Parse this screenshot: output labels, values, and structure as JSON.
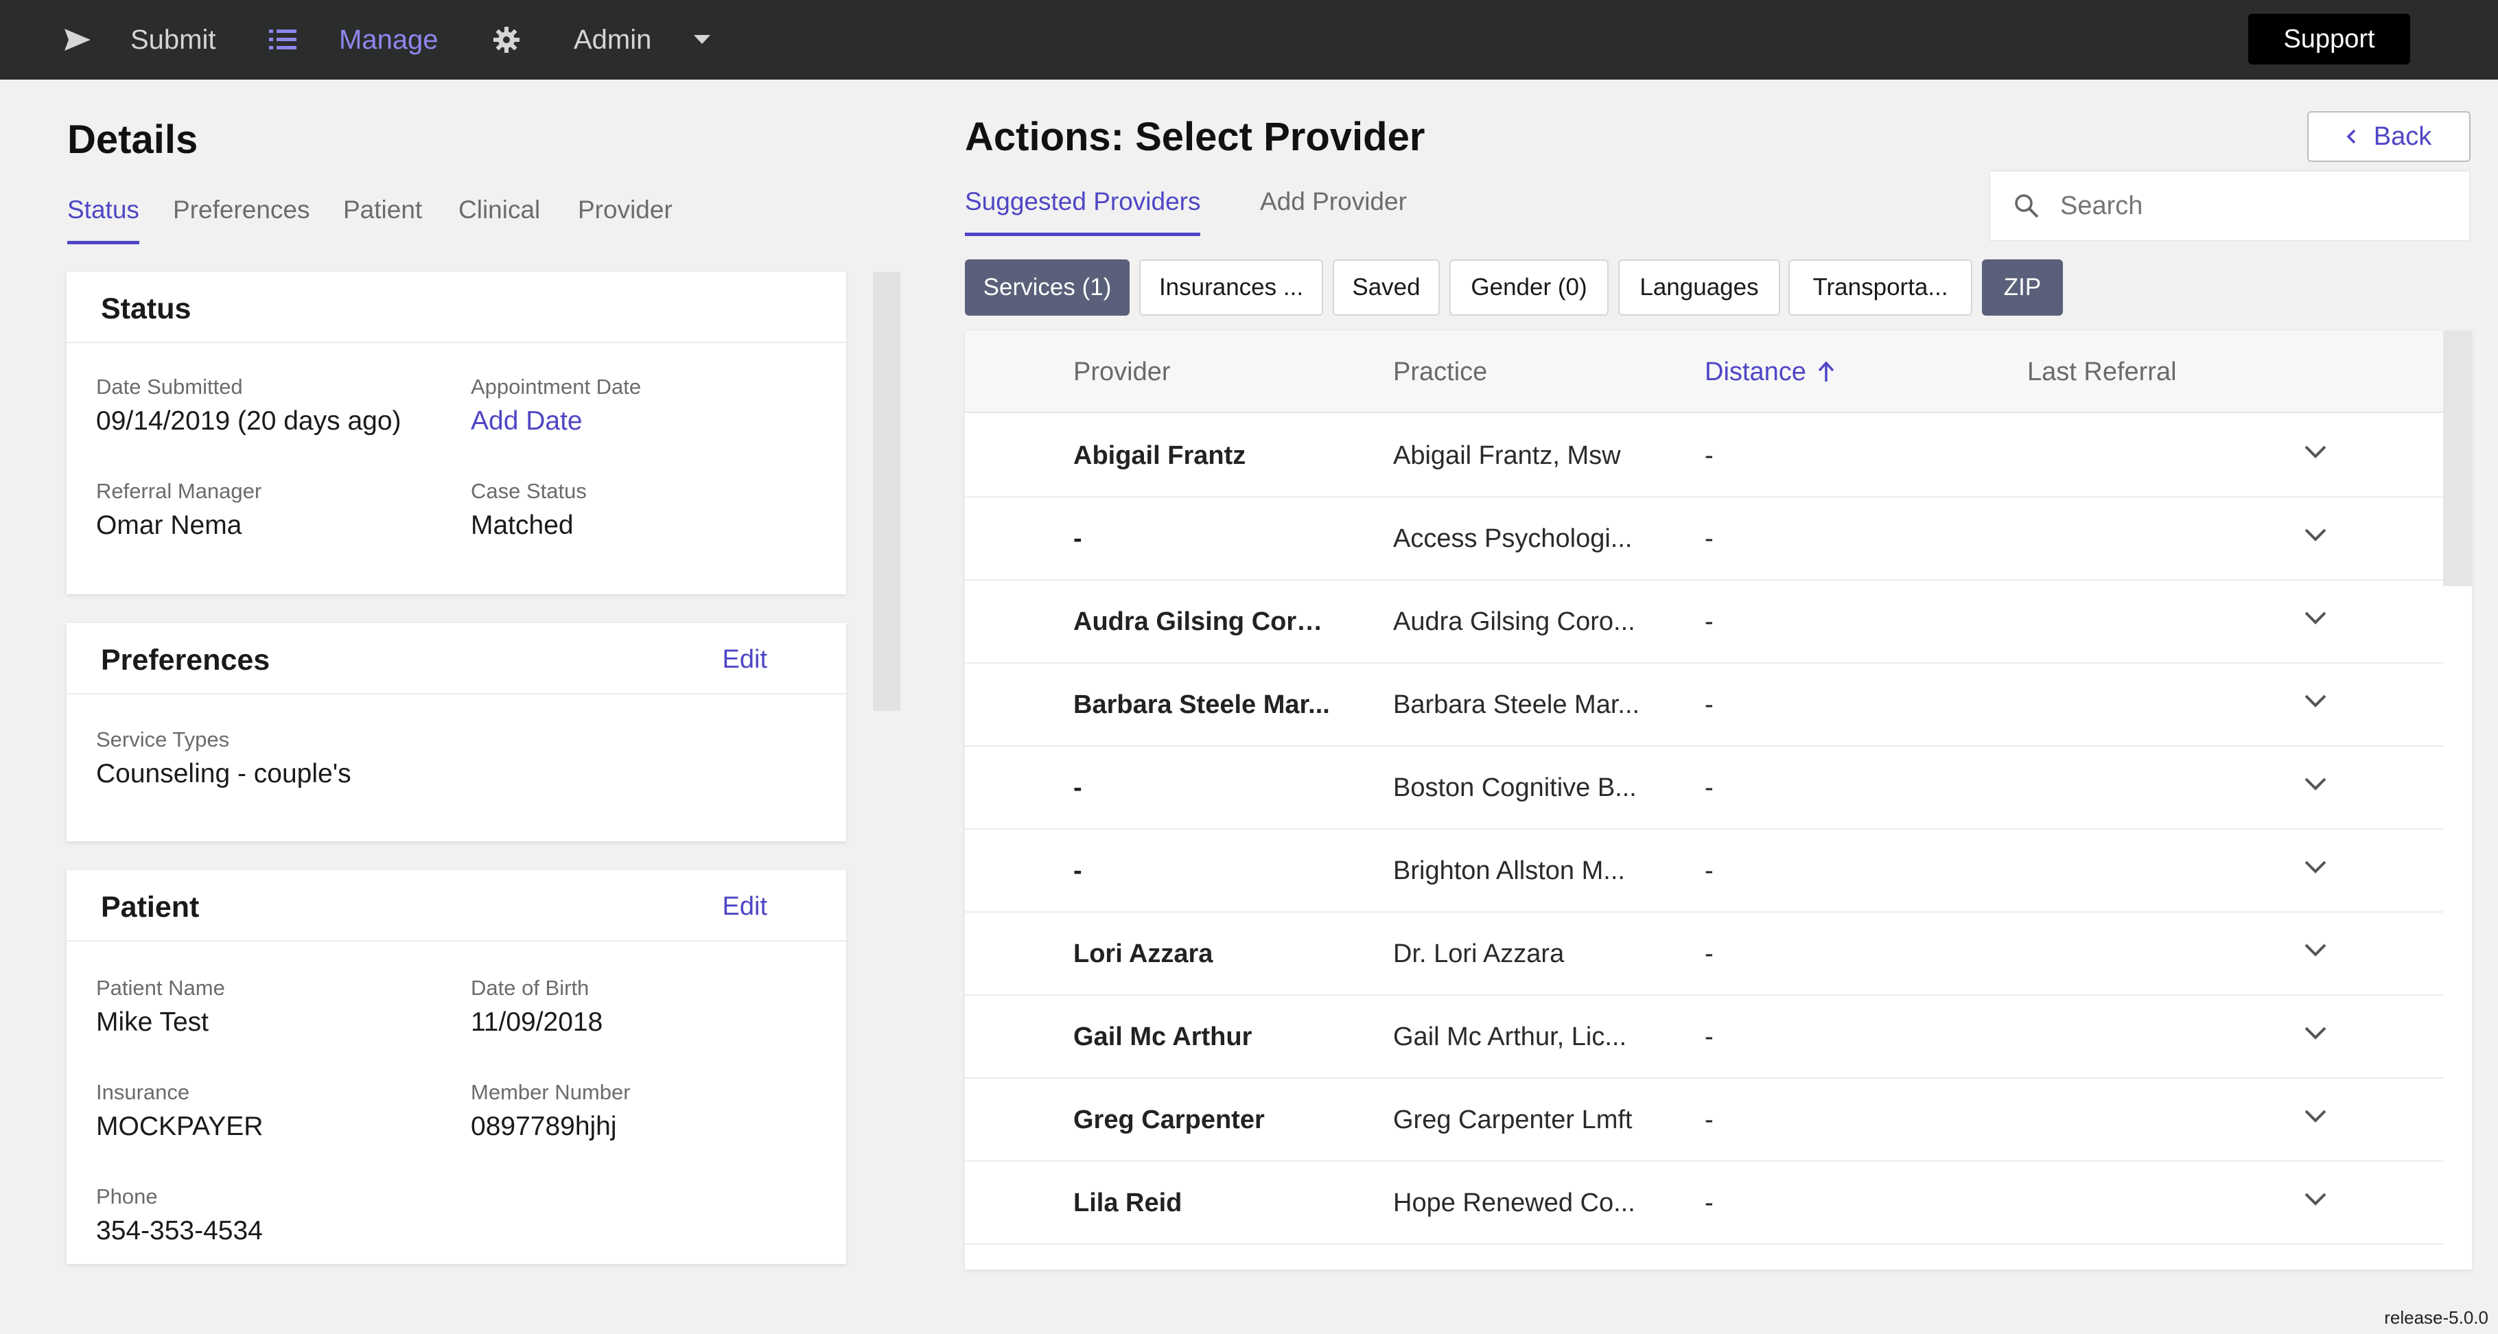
{
  "topbar": {
    "submit_label": "Submit",
    "manage_label": "Manage",
    "admin_label": "Admin",
    "support_label": "Support"
  },
  "details": {
    "title": "Details",
    "tabs": [
      "Status",
      "Preferences",
      "Patient",
      "Clinical",
      "Provider"
    ],
    "active_tab": "Status"
  },
  "status_card": {
    "title": "Status",
    "date_submitted_label": "Date Submitted",
    "date_submitted_value": "09/14/2019 (20 days ago)",
    "appointment_date_label": "Appointment Date",
    "appointment_date_value": "Add Date",
    "referral_manager_label": "Referral Manager",
    "referral_manager_value": "Omar Nema",
    "case_status_label": "Case Status",
    "case_status_value": "Matched"
  },
  "preferences_card": {
    "title": "Preferences",
    "edit_label": "Edit",
    "service_types_label": "Service Types",
    "service_types_value": "Counseling - couple's"
  },
  "patient_card": {
    "title": "Patient",
    "edit_label": "Edit",
    "patient_name_label": "Patient Name",
    "patient_name_value": "Mike Test",
    "dob_label": "Date of Birth",
    "dob_value": "11/09/2018",
    "insurance_label": "Insurance",
    "insurance_value": "MOCKPAYER",
    "member_number_label": "Member Number",
    "member_number_value": "0897789hjhj",
    "phone_label": "Phone",
    "phone_value": "354-353-4534"
  },
  "actions": {
    "title": "Actions: Select Provider",
    "back_label": "Back",
    "tabs": [
      "Suggested Providers",
      "Add Provider"
    ],
    "active_tab": "Suggested Providers",
    "search_placeholder": "Search",
    "filters": [
      {
        "label": "Services (1)",
        "active": true
      },
      {
        "label": "Insurances ...",
        "active": false
      },
      {
        "label": "Saved",
        "active": false
      },
      {
        "label": "Gender (0)",
        "active": false
      },
      {
        "label": "Languages",
        "active": false
      },
      {
        "label": "Transporta...",
        "active": false
      },
      {
        "label": "ZIP",
        "active": true
      }
    ]
  },
  "table": {
    "columns": [
      "Provider",
      "Practice",
      "Distance",
      "Last Referral"
    ],
    "sorted_column": "Distance",
    "rows": [
      {
        "provider": "Abigail Frantz",
        "practice": "Abigail Frantz, Msw",
        "distance": "-",
        "last_referral": ""
      },
      {
        "provider": "-",
        "practice": "Access Psychologi...",
        "distance": "-",
        "last_referral": ""
      },
      {
        "provider": "Audra Gilsing Coro...",
        "practice": "Audra Gilsing Coro...",
        "distance": "-",
        "last_referral": ""
      },
      {
        "provider": "Barbara Steele Mar...",
        "practice": "Barbara Steele Mar...",
        "distance": "-",
        "last_referral": ""
      },
      {
        "provider": "-",
        "practice": "Boston Cognitive B...",
        "distance": "-",
        "last_referral": ""
      },
      {
        "provider": "-",
        "practice": "Brighton Allston M...",
        "distance": "-",
        "last_referral": ""
      },
      {
        "provider": "Lori Azzara",
        "practice": "Dr. Lori Azzara",
        "distance": "-",
        "last_referral": ""
      },
      {
        "provider": "Gail Mc Arthur",
        "practice": "Gail Mc Arthur, Lic...",
        "distance": "-",
        "last_referral": ""
      },
      {
        "provider": "Greg Carpenter",
        "practice": "Greg Carpenter Lmft",
        "distance": "-",
        "last_referral": ""
      },
      {
        "provider": "Lila Reid",
        "practice": "Hope Renewed Co...",
        "distance": "-",
        "last_referral": ""
      }
    ]
  },
  "footer": {
    "release": "release-5.0.0"
  },
  "colors": {
    "topbar_bg": "#2b2c2c",
    "accent": "#4f46c5",
    "nav_active": "#8e87ee",
    "filter_active_bg": "#5a6079"
  },
  "icons": [
    "send-icon",
    "list-icon",
    "gear-icon",
    "caret-down-icon",
    "chevron-left-icon",
    "search-icon",
    "arrow-up-icon",
    "chevron-down-icon"
  ]
}
